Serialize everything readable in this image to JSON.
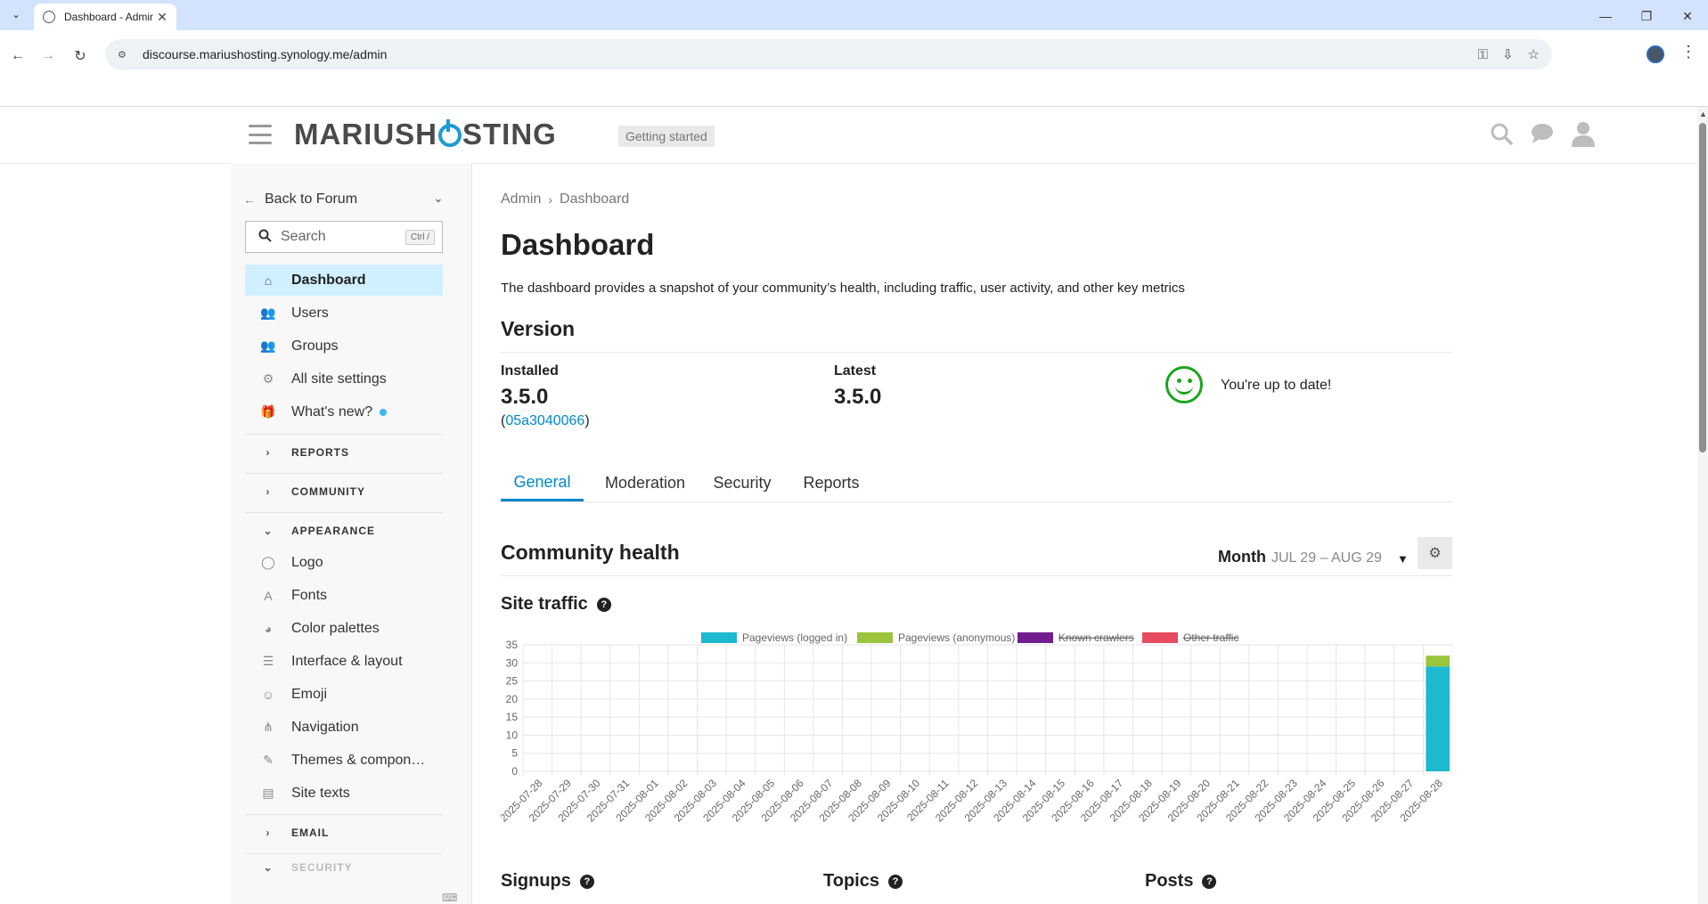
{
  "browser": {
    "tab_title": "Dashboard - Admin",
    "url": "discourse.mariushosting.synology.me/admin"
  },
  "header": {
    "logo_left": "MARIUSH",
    "logo_right": "STING",
    "getting_started": "Getting started"
  },
  "sidebar": {
    "back_label": "Back to Forum",
    "search_placeholder": "Search",
    "search_shortcut": "Ctrl /",
    "items": [
      {
        "label": "Dashboard",
        "icon": "home-icon",
        "active": true
      },
      {
        "label": "Users",
        "icon": "users-icon"
      },
      {
        "label": "Groups",
        "icon": "groups-icon"
      },
      {
        "label": "All site settings",
        "icon": "gear-icon"
      },
      {
        "label": "What's new?",
        "icon": "gift-icon",
        "dot": true
      }
    ],
    "sections": {
      "reports": "REPORTS",
      "community": "COMMUNITY",
      "appearance": "APPEARANCE",
      "email": "EMAIL",
      "security": "SECURITY"
    },
    "appearance_items": [
      {
        "label": "Logo",
        "icon": "logo-icon"
      },
      {
        "label": "Fonts",
        "icon": "font-icon"
      },
      {
        "label": "Color palettes",
        "icon": "palette-icon"
      },
      {
        "label": "Interface & layout",
        "icon": "layout-icon"
      },
      {
        "label": "Emoji",
        "icon": "emoji-icon"
      },
      {
        "label": "Navigation",
        "icon": "navigation-icon"
      },
      {
        "label": "Themes & compon…",
        "icon": "brush-icon"
      },
      {
        "label": "Site texts",
        "icon": "text-icon"
      }
    ]
  },
  "main": {
    "breadcrumb_root": "Admin",
    "breadcrumb_current": "Dashboard",
    "title": "Dashboard",
    "description": "The dashboard provides a snapshot of your community’s health, including traffic, user activity, and other key metrics",
    "version": {
      "title": "Version",
      "installed_label": "Installed",
      "installed": "3.5.0",
      "hash": "05a3040066",
      "latest_label": "Latest",
      "latest": "3.5.0",
      "status": "You're up to date!"
    },
    "tabs": [
      "General",
      "Moderation",
      "Security",
      "Reports"
    ],
    "community_health": "Community health",
    "period_label": "Month",
    "period_range": "JUL 29 – AUG 29",
    "site_traffic": "Site traffic",
    "signups": "Signups",
    "topics": "Topics",
    "posts": "Posts"
  },
  "colors": {
    "accent": "#0088cc",
    "logged_in": "#1eb8d1",
    "anonymous": "#9bc53d",
    "crawlers": "#721d8d",
    "other": "#e84a5f"
  },
  "chart_data": {
    "type": "bar",
    "stacked": true,
    "legend": [
      {
        "name": "Pageviews (logged in)",
        "color": "#1eb8d1",
        "hidden": false
      },
      {
        "name": "Pageviews (anonymous)",
        "color": "#9bc53d",
        "hidden": false
      },
      {
        "name": "Known crawlers",
        "color": "#721d8d",
        "hidden": true
      },
      {
        "name": "Other traffic",
        "color": "#e84a5f",
        "hidden": true
      }
    ],
    "legend_position": "top",
    "categories": [
      "2025-07-28",
      "2025-07-29",
      "2025-07-30",
      "2025-07-31",
      "2025-08-01",
      "2025-08-02",
      "2025-08-03",
      "2025-08-04",
      "2025-08-05",
      "2025-08-06",
      "2025-08-07",
      "2025-08-08",
      "2025-08-09",
      "2025-08-10",
      "2025-08-11",
      "2025-08-12",
      "2025-08-13",
      "2025-08-14",
      "2025-08-15",
      "2025-08-16",
      "2025-08-17",
      "2025-08-18",
      "2025-08-19",
      "2025-08-20",
      "2025-08-21",
      "2025-08-22",
      "2025-08-23",
      "2025-08-24",
      "2025-08-25",
      "2025-08-26",
      "2025-08-27",
      "2025-08-28"
    ],
    "series": [
      {
        "name": "Pageviews (logged in)",
        "values": [
          0,
          0,
          0,
          0,
          0,
          0,
          0,
          0,
          0,
          0,
          0,
          0,
          0,
          0,
          0,
          0,
          0,
          0,
          0,
          0,
          0,
          0,
          0,
          0,
          0,
          0,
          0,
          0,
          0,
          0,
          0,
          29
        ]
      },
      {
        "name": "Pageviews (anonymous)",
        "values": [
          0,
          0,
          0,
          0,
          0,
          0,
          0,
          0,
          0,
          0,
          0,
          0,
          0,
          0,
          0,
          0,
          0,
          0,
          0,
          0,
          0,
          0,
          0,
          0,
          0,
          0,
          0,
          0,
          0,
          0,
          0,
          3
        ]
      }
    ],
    "yticks": [
      0,
      5,
      10,
      15,
      20,
      25,
      30,
      35
    ],
    "ylim": [
      0,
      35
    ],
    "grid": true
  }
}
